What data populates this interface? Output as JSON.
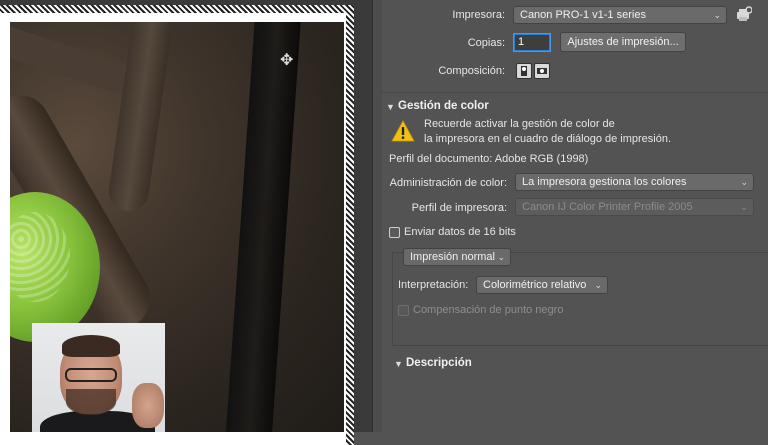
{
  "print": {
    "printer_label": "Impresora:",
    "printer_value": "Canon PRO-1 v1-1 series",
    "copies_label": "Copias:",
    "copies_value": "1",
    "print_settings_button": "Ajustes de impresión...",
    "layout_label": "Composición:"
  },
  "color": {
    "section_title": "Gestión de color",
    "warning_line1": "Recuerde activar la gestión de color de",
    "warning_line2": "la impresora en el cuadro de diálogo de impresión.",
    "doc_profile": "Perfil del documento: Adobe RGB (1998)",
    "color_handling_label": "Administración de color:",
    "color_handling_value": "La impresora gestiona los colores",
    "printer_profile_label": "Perfil de impresora:",
    "printer_profile_value": "Canon IJ Color Printer Profile 2005",
    "send16_label": "Enviar datos de 16 bits",
    "print_mode_value": "Impresión normal",
    "intent_label": "Interpretación:",
    "intent_value": "Colorimétrico relativo",
    "bpc_label": "Compensación de punto negro"
  },
  "description": {
    "section_title": "Descripción"
  },
  "icons": {
    "chevron": "⌄",
    "expand": "▼",
    "move": "✥"
  }
}
